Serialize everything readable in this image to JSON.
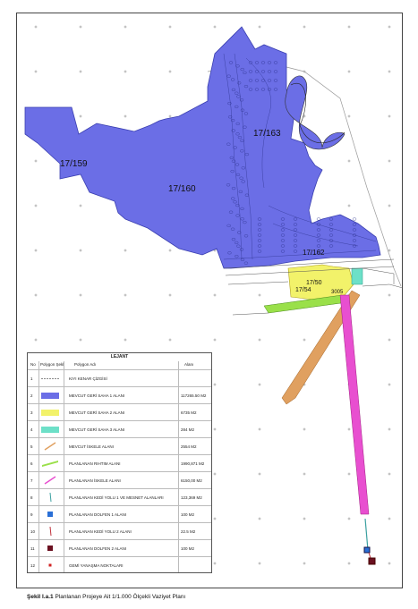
{
  "parcels": [
    {
      "label": "17/159",
      "color": "#6b6ee6"
    },
    {
      "label": "17/160",
      "color": "#6b6ee6"
    },
    {
      "label": "17/163",
      "color": "#6b6ee6"
    },
    {
      "label": "17/162",
      "color": "#6b6ee6"
    },
    {
      "label": "17/50",
      "color": "#f2f26a"
    },
    {
      "label": "17/54",
      "color": "#f2f26a"
    },
    {
      "label": "3005",
      "color": "#f2f26a"
    }
  ],
  "legend": {
    "title": "LEJANT",
    "headers": {
      "no": "No",
      "symbol": "Polygon Şekli",
      "name": "Polygon Adı",
      "area": "Alanı"
    },
    "rows": [
      {
        "no": "1",
        "name": "KIYI KENAR ÇİZGİSİ",
        "area": "",
        "symbol": "line-dash",
        "color": "#888888"
      },
      {
        "no": "2",
        "name": "MEVCUT GERİ SAHA 1 ALANI",
        "area": "117265.50 M2",
        "symbol": "fill",
        "color": "#6b6ee6"
      },
      {
        "no": "3",
        "name": "MEVCUT GERİ SAHA 2 ALANI",
        "area": "6735 M2",
        "symbol": "fill",
        "color": "#f2f26a"
      },
      {
        "no": "4",
        "name": "MEVCUT GERİ SAHA 3 ALANI",
        "area": "284 M2",
        "symbol": "fill",
        "color": "#6de0c8"
      },
      {
        "no": "5",
        "name": "MEVCUT İSKELE ALANI",
        "area": "2554 M2",
        "symbol": "diag",
        "color": "#e0a060"
      },
      {
        "no": "6",
        "name": "PLANLANAN RIHTIM ALANI",
        "area": "1990,871 M2",
        "symbol": "leaf",
        "color": "#9ae04a"
      },
      {
        "no": "7",
        "name": "PLANLANAN İSKELE ALANI",
        "area": "6150,00 M2",
        "symbol": "diag",
        "color": "#e84fd0"
      },
      {
        "no": "8",
        "name": "PLANLANAN KEDİ YOLU 1 VE MESNET ALANLARI",
        "area": "123,369 M2",
        "symbol": "vline",
        "color": "#3aa0a0"
      },
      {
        "no": "9",
        "name": "PLANLANAN DOLFEN 1 ALANI",
        "area": "100 M2",
        "symbol": "square",
        "color": "#2a6fd6"
      },
      {
        "no": "10",
        "name": "PLANLANAN KEDİ YOLU 2 ALANI",
        "area": "22.5 M2",
        "symbol": "vline",
        "color": "#c0303a"
      },
      {
        "no": "11",
        "name": "PLANLANAN DOLFEN 2 ALANI",
        "area": "100 M2",
        "symbol": "square",
        "color": "#6b1020"
      },
      {
        "no": "12",
        "name": "GEMİ YANAŞMA NOKTALARI",
        "area": "",
        "symbol": "dot",
        "color": "#d02020"
      }
    ]
  },
  "caption": {
    "bold": "Şekil I.a.1",
    "text": "Planlanan Projeye Ait 1/1.000 Ölçekli Vaziyet Planı"
  }
}
